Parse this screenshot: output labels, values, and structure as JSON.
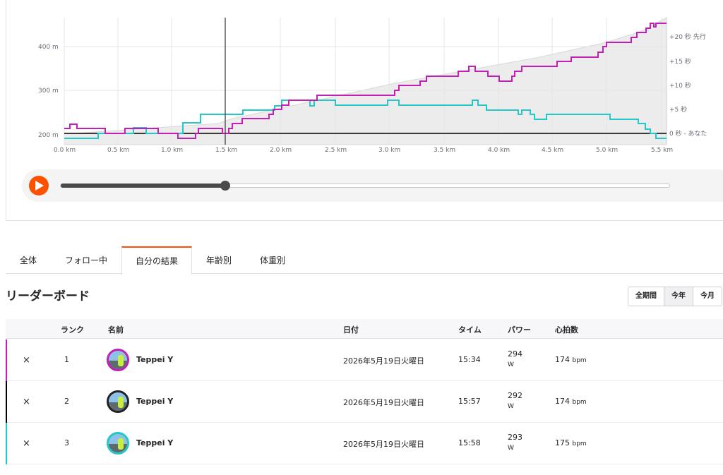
{
  "chart": {
    "y_labels": [
      "400 m",
      "300 m",
      "200 m"
    ],
    "x_labels": [
      "0.0 km",
      "0.5 km",
      "1.0 km",
      "1.5 km",
      "2.0 km",
      "2.5 km",
      "3.0 km",
      "3.5 km",
      "4.0 km",
      "4.5 km",
      "5.0 km",
      "5.5 km"
    ],
    "right_labels": [
      "+20 秒 先行",
      "+15 秒",
      "+10 秒",
      "+5 秒",
      "0 秒 - あなた"
    ],
    "colors": {
      "magenta": "#c21fb5",
      "cyan": "#27c7c7",
      "black": "#000000",
      "elevation": "#ececec"
    }
  },
  "player": {
    "play_icon": "play-icon",
    "progress": 0.27
  },
  "tabs": [
    {
      "label": "全体"
    },
    {
      "label": "フォロー中"
    },
    {
      "label": "自分の結果"
    },
    {
      "label": "年齢別"
    },
    {
      "label": "体重別"
    }
  ],
  "leaderboard": {
    "title": "リーダーボード",
    "ranges": [
      "全期間",
      "今年",
      "今月"
    ],
    "headers": {
      "rank": "ランク",
      "name": "名前",
      "date": "日付",
      "time": "タイム",
      "power": "パワー",
      "hr": "心拍数"
    },
    "rows": [
      {
        "remove": "×",
        "rank": "1",
        "name": "Teppei Y",
        "date": "2026年5月19日火曜日",
        "time": "15:34",
        "power": "294",
        "power_unit": "W",
        "hr": "174",
        "hr_unit": "bpm",
        "color": "#c21fb5"
      },
      {
        "remove": "×",
        "rank": "2",
        "name": "Teppei Y",
        "date": "2026年5月19日火曜日",
        "time": "15:57",
        "power": "292",
        "power_unit": "W",
        "hr": "174",
        "hr_unit": "bpm",
        "color": "#000000"
      },
      {
        "remove": "×",
        "rank": "3",
        "name": "Teppei Y",
        "date": "2026年5月19日火曜日",
        "time": "15:58",
        "power": "293",
        "power_unit": "W",
        "hr": "175",
        "hr_unit": "bpm",
        "color": "#27c7c7"
      }
    ]
  }
}
